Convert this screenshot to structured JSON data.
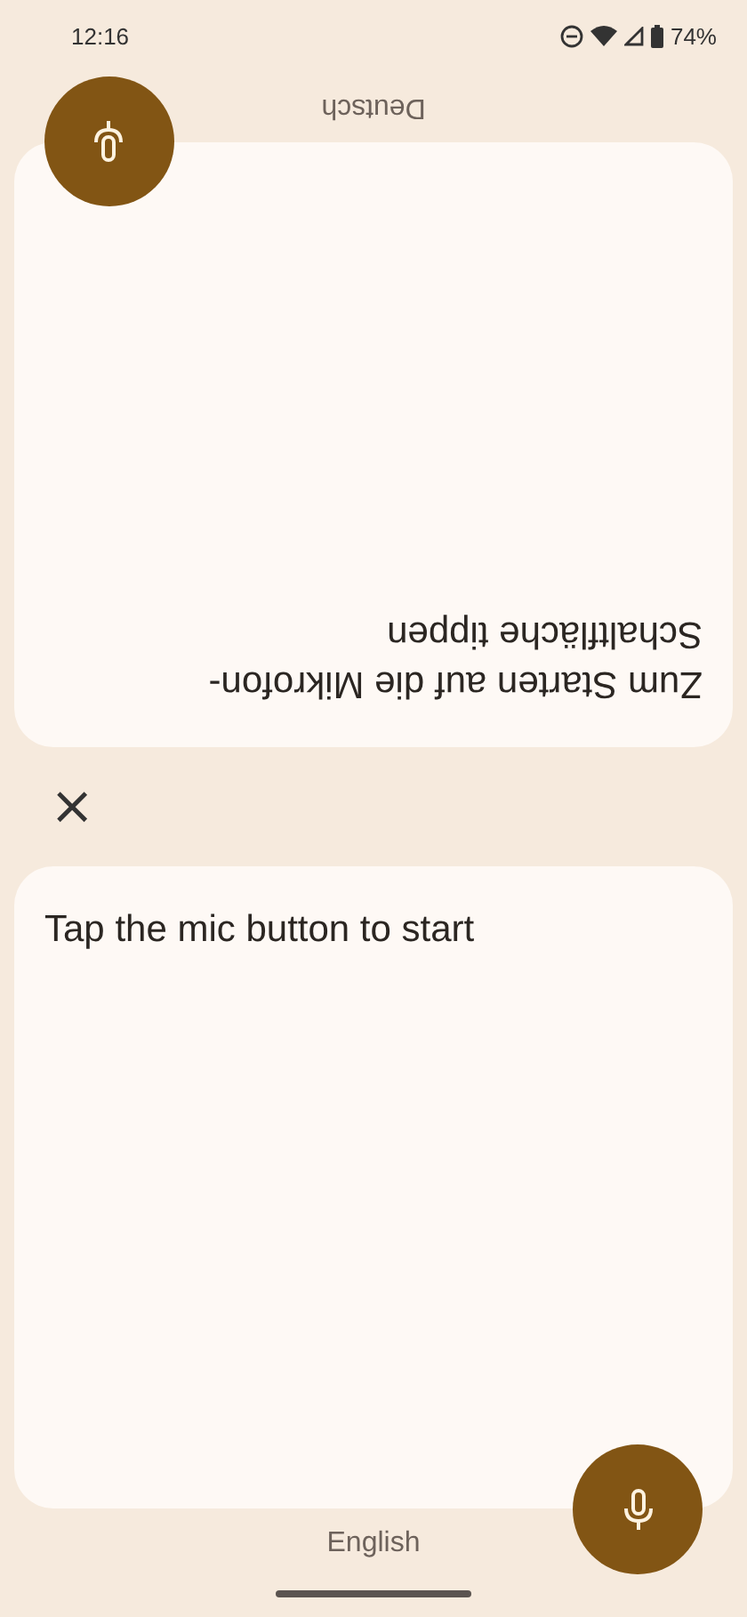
{
  "status_bar": {
    "time": "12:16",
    "battery": "74%"
  },
  "panes": [
    {
      "language": "Deutsch",
      "prompt": "Zum Starten auf die Mikrofon-Schaltfläche tippen",
      "upside_down": true
    },
    {
      "language": "English",
      "prompt": "Tap the mic button to start",
      "upside_down": false
    }
  ],
  "close_button": {
    "label": "×"
  }
}
